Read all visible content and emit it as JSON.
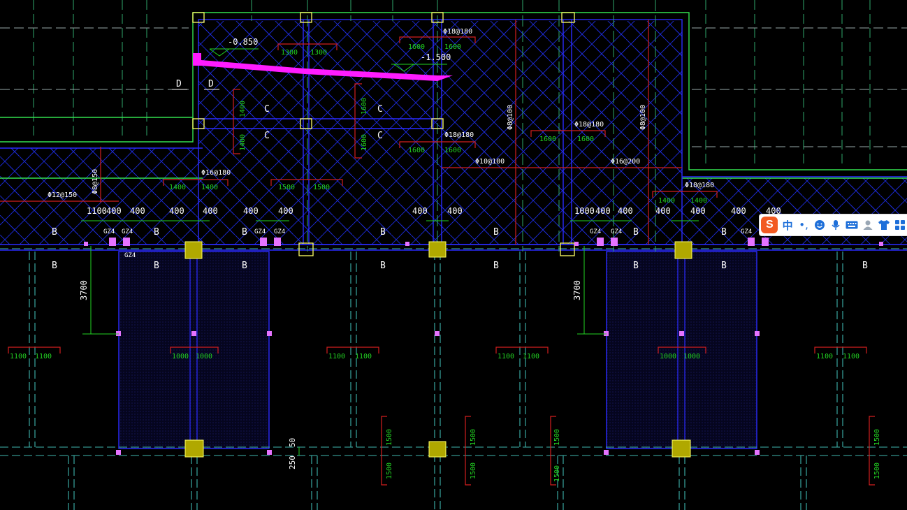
{
  "drawing": {
    "colors": {
      "background": "#000000",
      "grid_major": "#2fa86b",
      "grid_dashed": "#3fb7b0",
      "wall": "#2b2bff",
      "hatch": "#1c2ad6",
      "dim_green": "#22d322",
      "rebar_red": "#d31f1f",
      "column_fill": "#b0a800",
      "column_outline": "#ffff66",
      "ramp": "#ff1cff",
      "pink_marker": "#e573ff",
      "outline_green": "#33e04f",
      "text_white": "#ffffff"
    },
    "elevations": [
      "-0.850",
      "-1.500"
    ],
    "section_marks": [
      "D",
      "C",
      "B"
    ],
    "constructional_column": "GZ4",
    "top_rebar_labels": [
      "Φ18@180",
      "Φ18@180",
      "Φ16@180",
      "Φ18@180",
      "Φ10@100",
      "Φ16@200",
      "Φ18@180",
      "Φ12@150"
    ],
    "vertical_rebar_labels": [
      "Φ8@100",
      "Φ8@100",
      "Φ8@150"
    ],
    "upper_dims": [
      "1300",
      "1300",
      "1600",
      "1600",
      "1400",
      "1400",
      "1600",
      "1600",
      "1600",
      "1600",
      "1600",
      "1600",
      "1400",
      "1400",
      "1500",
      "1500",
      "1400",
      "1400"
    ],
    "spacing_dims": [
      "1100",
      "400",
      "400",
      "400",
      "400",
      "400",
      "400",
      "400",
      "400",
      "1000",
      "400",
      "400",
      "400",
      "400",
      "400",
      "400"
    ],
    "lower_dims": [
      "1100",
      "1100",
      "1000",
      "1000",
      "1100",
      "1100",
      "1100",
      "1100",
      "1000",
      "1000",
      "1100",
      "1100"
    ],
    "vertical_dims": [
      "3700",
      "3700",
      "1500",
      "1500",
      "1500",
      "1500",
      "1500",
      "1500",
      "1500",
      "1500",
      "50",
      "250"
    ]
  },
  "ime_toolbar": {
    "logo_letter": "S",
    "lang_label": "中",
    "punct_label": "•,",
    "emoji_icon": "emoji-icon",
    "mic_icon": "microphone-icon",
    "keyboard_icon": "keyboard-icon",
    "user_icon": "user-icon",
    "skin_icon": "tshirt-icon",
    "grid_icon": "apps-grid-icon"
  }
}
